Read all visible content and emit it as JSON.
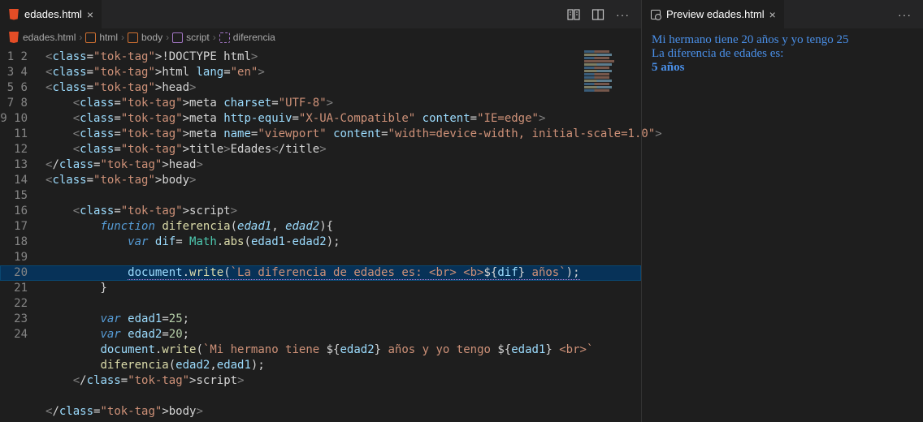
{
  "editor": {
    "tab": {
      "label": "edades.html"
    },
    "breadcrumb": [
      {
        "icon": "html5",
        "label": "edades.html"
      },
      {
        "icon": "ohtml",
        "label": "html"
      },
      {
        "icon": "obody",
        "label": "body"
      },
      {
        "icon": "oscript",
        "label": "script"
      },
      {
        "icon": "ofunc",
        "label": "diferencia"
      }
    ],
    "highlight_line": 15,
    "lines": [
      "<!DOCTYPE html>",
      "<html lang=\"en\">",
      "<head>",
      "    <meta charset=\"UTF-8\">",
      "    <meta http-equiv=\"X-UA-Compatible\" content=\"IE=edge\">",
      "    <meta name=\"viewport\" content=\"width=device-width, initial-scale=1.0\">",
      "    <title>Edades</title>",
      "</head>",
      "<body>",
      "",
      "    <script>",
      "        function diferencia(edad1, edad2){",
      "            var dif= Math.abs(edad1-edad2);",
      "",
      "            document.write(`La diferencia de edades es: <br> <b>${dif} años`);",
      "        }",
      "",
      "        var edad1=25;",
      "        var edad2=20;",
      "        document.write(`Mi hermano tiene ${edad2} años y yo tengo ${edad1} <br>`",
      "        diferencia(edad2,edad1);",
      "    </script>",
      "",
      "</body>"
    ]
  },
  "preview": {
    "tab": {
      "label": "Preview edades.html"
    },
    "line1": "Mi hermano tiene 20 años y yo tengo 25",
    "line2": "La diferencia de edades es:",
    "line3": "5 años"
  }
}
